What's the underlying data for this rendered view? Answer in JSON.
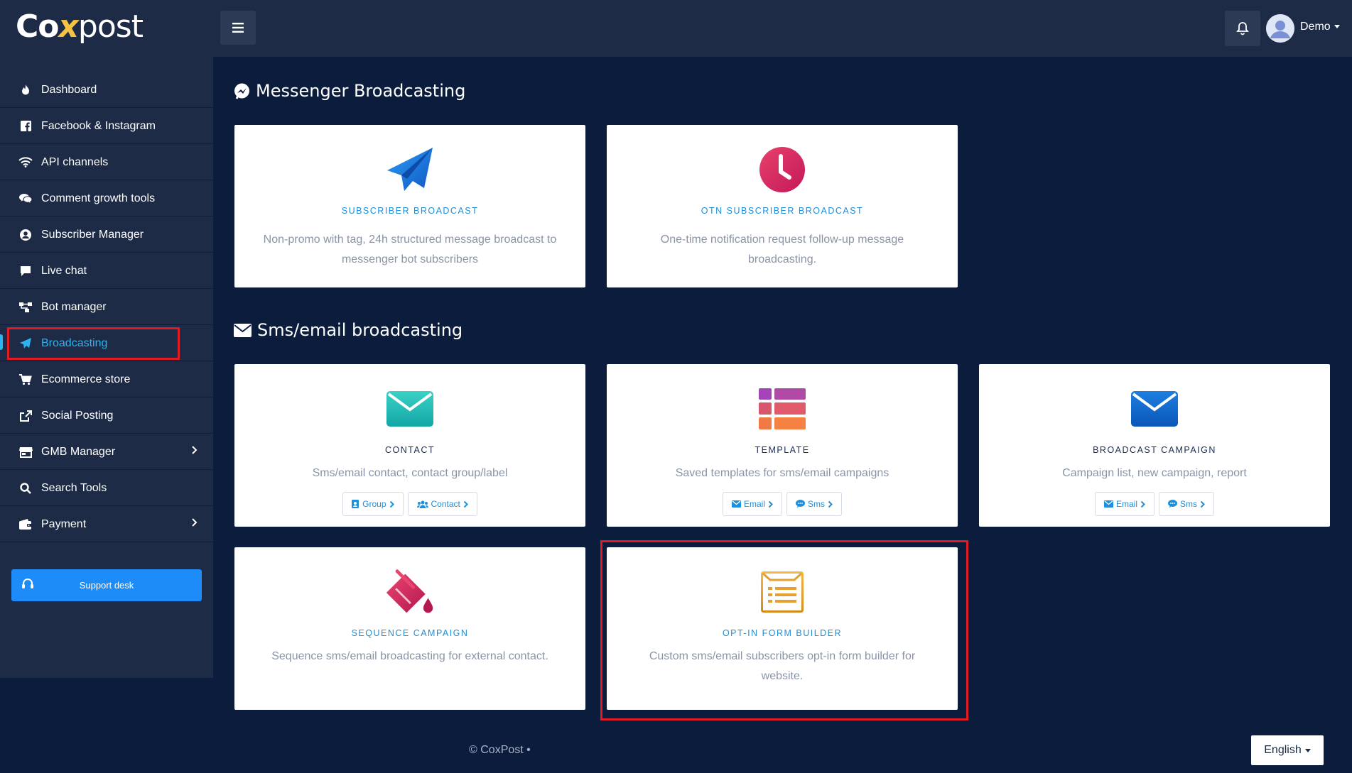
{
  "brand": {
    "logo_co": "Co",
    "logo_x": "x",
    "logo_post": "post"
  },
  "header": {
    "user_name": "Demo",
    "menu_icon": "hamburger-icon",
    "bell_icon": "bell-icon"
  },
  "sidebar": {
    "items": [
      {
        "label": "Dashboard",
        "icon": "fire-icon"
      },
      {
        "label": "Facebook & Instagram",
        "icon": "facebook-icon"
      },
      {
        "label": "API channels",
        "icon": "wifi-icon"
      },
      {
        "label": "Comment growth tools",
        "icon": "comments-icon"
      },
      {
        "label": "Subscriber Manager",
        "icon": "user-circle-icon"
      },
      {
        "label": "Live chat",
        "icon": "chat-icon"
      },
      {
        "label": "Bot manager",
        "icon": "sitemap-icon"
      },
      {
        "label": "Broadcasting",
        "icon": "paper-plane-icon",
        "active": true
      },
      {
        "label": "Ecommerce store",
        "icon": "cart-icon"
      },
      {
        "label": "Social Posting",
        "icon": "share-icon"
      },
      {
        "label": "GMB Manager",
        "icon": "store-icon",
        "has_submenu": true
      },
      {
        "label": "Search Tools",
        "icon": "search-icon"
      },
      {
        "label": "Payment",
        "icon": "wallet-icon",
        "has_submenu": true
      }
    ],
    "support_label": "Support desk"
  },
  "sections": {
    "messenger": {
      "title": "Messenger Broadcasting",
      "cards": [
        {
          "title": "SUBSCRIBER BROADCAST",
          "desc": "Non-promo with tag, 24h structured message broadcast to messenger bot subscribers",
          "icon": "paper-plane-icon"
        },
        {
          "title": "OTN SUBSCRIBER BROADCAST",
          "desc": "One-time notification request follow-up message broadcasting.",
          "icon": "clock-icon"
        }
      ]
    },
    "sms": {
      "title": "Sms/email broadcasting",
      "cards": [
        {
          "title": "CONTACT",
          "desc": "Sms/email contact, contact group/label",
          "icon": "envelope-icon",
          "buttons": [
            "Group",
            "Contact"
          ]
        },
        {
          "title": "TEMPLATE",
          "desc": "Saved templates for sms/email campaigns",
          "icon": "template-grid-icon",
          "buttons": [
            "Email",
            "Sms"
          ]
        },
        {
          "title": "BROADCAST CAMPAIGN",
          "desc": "Campaign list, new campaign, report",
          "icon": "envelope-icon",
          "buttons": [
            "Email",
            "Sms"
          ]
        },
        {
          "title": "SEQUENCE CAMPAIGN",
          "desc": "Sequence sms/email broadcasting for external contact.",
          "icon": "paint-bucket-icon"
        },
        {
          "title": "OPT-IN FORM BUILDER",
          "desc": "Custom sms/email subscribers opt-in form builder for website.",
          "icon": "form-icon"
        }
      ]
    }
  },
  "footer": {
    "copyright": "© CoxPost  •",
    "language": "English"
  },
  "colors": {
    "accent": "#2ab5f0",
    "highlight": "#e01b24",
    "sidebar": "#1e2b47",
    "background": "#0b1c3d"
  }
}
